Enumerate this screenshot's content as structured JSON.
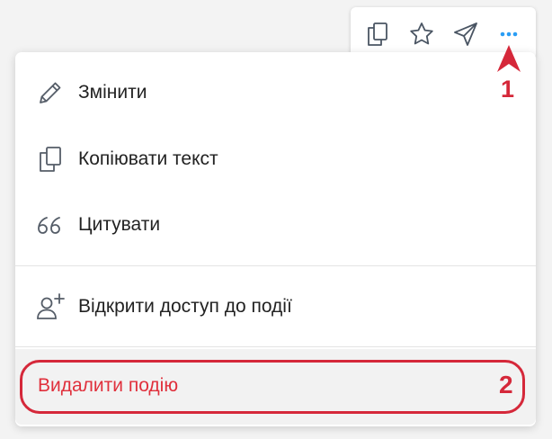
{
  "toolbar": {
    "buttons": [
      {
        "icon": "copy-icon"
      },
      {
        "icon": "star-icon"
      },
      {
        "icon": "send-icon"
      },
      {
        "icon": "more-icon"
      }
    ],
    "accent_color": "#2a9df4"
  },
  "menu": {
    "items": [
      {
        "label": "Змінити",
        "icon": "pencil-icon"
      },
      {
        "label": "Копіювати текст",
        "icon": "copy-icon"
      },
      {
        "label": "Цитувати",
        "icon": "quote-icon"
      },
      {
        "label": "Відкрити доступ до події",
        "icon": "add-user-icon"
      }
    ],
    "delete": {
      "label": "Видалити подію",
      "color": "#e0303c"
    }
  },
  "annotations": {
    "marker_1": "1",
    "marker_2": "2",
    "color": "#d5283a"
  }
}
